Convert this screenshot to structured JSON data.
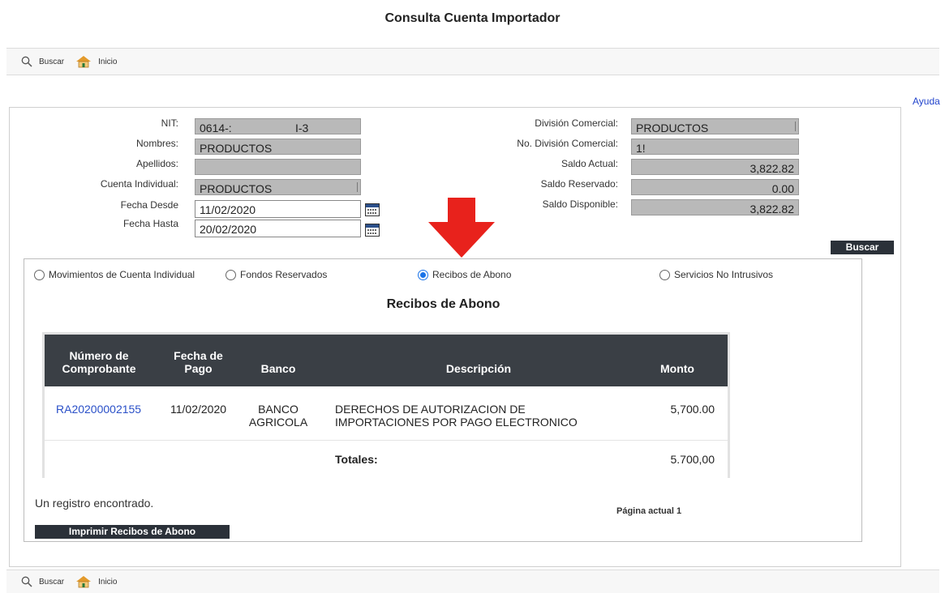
{
  "page": {
    "title": "Consulta Cuenta Importador",
    "help": "Ayuda"
  },
  "toolbar": {
    "search_label": "Buscar",
    "home_label": "Inicio"
  },
  "form": {
    "nit": {
      "label": "NIT:",
      "value": "0614-:",
      "value_suffix": "I-3"
    },
    "nombres": {
      "label": "Nombres:",
      "value": "PRODUCTOS"
    },
    "apellidos": {
      "label": "Apellidos:",
      "value": ""
    },
    "cuenta_individual": {
      "label": "Cuenta Individual:",
      "value": "PRODUCTOS"
    },
    "fecha_desde": {
      "label": "Fecha Desde",
      "value": "11/02/2020"
    },
    "fecha_hasta": {
      "label": "Fecha Hasta",
      "value": "20/02/2020"
    },
    "division_comercial": {
      "label": "División Comercial:",
      "value": "PRODUCTOS"
    },
    "no_division_comercial": {
      "label": "No. División Comercial:",
      "value": "1!"
    },
    "saldo_actual": {
      "label": "Saldo Actual:",
      "value": "3,822.82"
    },
    "saldo_reservado": {
      "label": "Saldo Reservado:",
      "value": "0.00"
    },
    "saldo_disponible": {
      "label": "Saldo Disponible:",
      "value": "3,822.82"
    },
    "search_button": "Buscar"
  },
  "options": {
    "items": [
      {
        "label": "Movimientos de Cuenta Individual",
        "selected": false
      },
      {
        "label": "Fondos Reservados",
        "selected": false
      },
      {
        "label": "Recibos de Abono",
        "selected": true
      },
      {
        "label": "Servicios No Intrusivos",
        "selected": false
      }
    ]
  },
  "section": {
    "title": "Recibos de Abono"
  },
  "table": {
    "headers": {
      "comprobante": "Número de Comprobante",
      "fecha": "Fecha de Pago",
      "banco": "Banco",
      "descripcion": "Descripción",
      "monto": "Monto"
    },
    "rows": [
      {
        "comprobante": "RA20200002155",
        "fecha": "11/02/2020",
        "banco": "BANCO AGRICOLA",
        "descripcion": "DERECHOS DE AUTORIZACION DE IMPORTACIONES POR PAGO ELECTRONICO",
        "monto": "5,700.00"
      }
    ],
    "totals": {
      "label": "Totales:",
      "value": "5.700,00"
    }
  },
  "footer": {
    "records": "Un registro encontrado.",
    "page": "Página actual 1",
    "print_button": "Imprimir Recibos de Abono"
  },
  "colors": {
    "accent_link": "#2a50c8",
    "header_bg": "#3a3f45",
    "arrow": "#e8221c",
    "readonly_bg": "#b9b9b9"
  }
}
